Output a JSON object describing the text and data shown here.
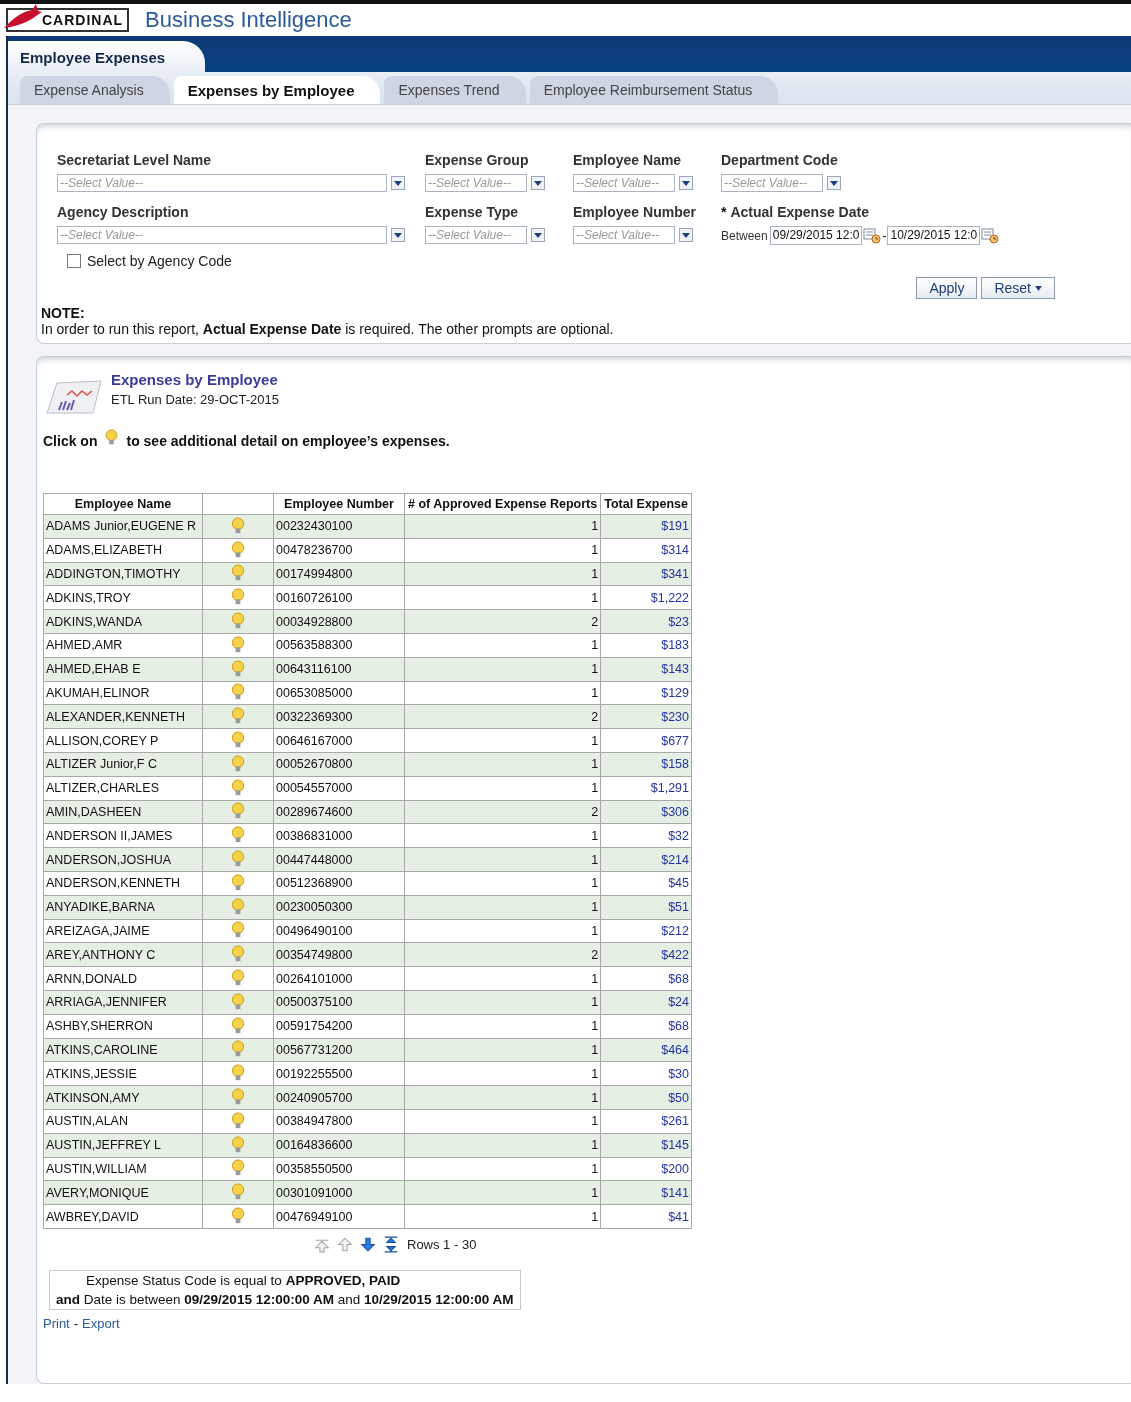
{
  "header": {
    "logo_text": "CARDINAL",
    "title": "Business Intelligence"
  },
  "dashboard": {
    "title": "Employee Expenses"
  },
  "tabs": [
    {
      "label": "Expense Analysis",
      "selected": false
    },
    {
      "label": "Expenses by Employee",
      "selected": true
    },
    {
      "label": "Expenses Trend",
      "selected": false
    },
    {
      "label": "Employee Reimbursement Status",
      "selected": false
    }
  ],
  "prompts": [
    {
      "kind": "select",
      "label": "Secretariat Level Name",
      "placeholder": "--Select Value--"
    },
    {
      "kind": "select",
      "label": "Expense Group",
      "placeholder": "--Select Value--"
    },
    {
      "kind": "select",
      "label": "Employee Name",
      "placeholder": "--Select Value--"
    },
    {
      "kind": "select",
      "label": "Department Code",
      "placeholder": "--Select Value--"
    },
    {
      "kind": "select",
      "label": "Agency Description",
      "placeholder": "--Select Value--"
    },
    {
      "kind": "select",
      "label": "Expense Type",
      "placeholder": "--Select Value--"
    },
    {
      "kind": "select",
      "label": "Employee Number",
      "placeholder": "--Select Value--"
    },
    {
      "kind": "date_range",
      "label": "Actual Expense Date",
      "required_mark": "*",
      "prefix": "Between",
      "from": "09/29/2015 12:0",
      "separator": "-",
      "to": "10/29/2015 12:0"
    }
  ],
  "agency_code_checkbox": {
    "label": "Select by Agency Code",
    "checked": false
  },
  "buttons": [
    {
      "label": "Apply",
      "kind": "plain"
    },
    {
      "label": "Reset",
      "kind": "menu"
    }
  ],
  "note": {
    "title": "NOTE:",
    "text": "In order to run this report, **Actual Expense Date** is required. The other prompts are optional."
  },
  "report": {
    "title": "Expenses by Employee",
    "etl_run_date": "ETL Run Date: 29-OCT-2015",
    "hint_before": "Click on",
    "hint_after": "to see additional detail on employee’s expenses."
  },
  "table": {
    "columns": [
      {
        "kind": "text",
        "label": "Employee Name"
      },
      {
        "kind": "detail"
      },
      {
        "kind": "text",
        "label": "Employee Number"
      },
      {
        "kind": "number",
        "label": "# of Approved Expense Reports"
      },
      {
        "kind": "money",
        "label": "Total Expense"
      }
    ],
    "rows": [
      {
        "name": "ADAMS Junior,EUGENE R",
        "number": "00232430100",
        "reports": "1",
        "total": "$191"
      },
      {
        "name": "ADAMS,ELIZABETH",
        "number": "00478236700",
        "reports": "1",
        "total": "$314"
      },
      {
        "name": "ADDINGTON,TIMOTHY",
        "number": "00174994800",
        "reports": "1",
        "total": "$341"
      },
      {
        "name": "ADKINS,TROY",
        "number": "00160726100",
        "reports": "1",
        "total": "$1,222"
      },
      {
        "name": "ADKINS,WANDA",
        "number": "00034928800",
        "reports": "2",
        "total": "$23"
      },
      {
        "name": "AHMED,AMR",
        "number": "00563588300",
        "reports": "1",
        "total": "$183"
      },
      {
        "name": "AHMED,EHAB E",
        "number": "00643116100",
        "reports": "1",
        "total": "$143"
      },
      {
        "name": "AKUMAH,ELINOR",
        "number": "00653085000",
        "reports": "1",
        "total": "$129"
      },
      {
        "name": "ALEXANDER,KENNETH",
        "number": "00322369300",
        "reports": "2",
        "total": "$230"
      },
      {
        "name": "ALLISON,COREY P",
        "number": "00646167000",
        "reports": "1",
        "total": "$677"
      },
      {
        "name": "ALTIZER Junior,F C",
        "number": "00052670800",
        "reports": "1",
        "total": "$158"
      },
      {
        "name": "ALTIZER,CHARLES",
        "number": "00054557000",
        "reports": "1",
        "total": "$1,291"
      },
      {
        "name": "AMIN,DASHEEN",
        "number": "00289674600",
        "reports": "2",
        "total": "$306"
      },
      {
        "name": "ANDERSON II,JAMES",
        "number": "00386831000",
        "reports": "1",
        "total": "$32"
      },
      {
        "name": "ANDERSON,JOSHUA",
        "number": "00447448000",
        "reports": "1",
        "total": "$214"
      },
      {
        "name": "ANDERSON,KENNETH",
        "number": "00512368900",
        "reports": "1",
        "total": "$45"
      },
      {
        "name": "ANYADIKE,BARNA",
        "number": "00230050300",
        "reports": "1",
        "total": "$51"
      },
      {
        "name": "AREIZAGA,JAIME",
        "number": "00496490100",
        "reports": "1",
        "total": "$212"
      },
      {
        "name": "AREY,ANTHONY C",
        "number": "00354749800",
        "reports": "2",
        "total": "$422"
      },
      {
        "name": "ARNN,DONALD",
        "number": "00264101000",
        "reports": "1",
        "total": "$68"
      },
      {
        "name": "ARRIAGA,JENNIFER",
        "number": "00500375100",
        "reports": "1",
        "total": "$24"
      },
      {
        "name": "ASHBY,SHERRON",
        "number": "00591754200",
        "reports": "1",
        "total": "$68"
      },
      {
        "name": "ATKINS,CAROLINE",
        "number": "00567731200",
        "reports": "1",
        "total": "$464"
      },
      {
        "name": "ATKINS,JESSIE",
        "number": "00192255500",
        "reports": "1",
        "total": "$30"
      },
      {
        "name": "ATKINSON,AMY",
        "number": "00240905700",
        "reports": "1",
        "total": "$50"
      },
      {
        "name": "AUSTIN,ALAN",
        "number": "00384947800",
        "reports": "1",
        "total": "$261"
      },
      {
        "name": "AUSTIN,JEFFREY L",
        "number": "00164836600",
        "reports": "1",
        "total": "$145"
      },
      {
        "name": "AUSTIN,WILLIAM",
        "number": "00358550500",
        "reports": "1",
        "total": "$200"
      },
      {
        "name": "AVERY,MONIQUE",
        "number": "00301091000",
        "reports": "1",
        "total": "$141"
      },
      {
        "name": "AWBREY,DAVID",
        "number": "00476949100",
        "reports": "1",
        "total": "$41"
      }
    ]
  },
  "pager": {
    "controls": [
      {
        "kind": "first",
        "disabled": true
      },
      {
        "kind": "previous",
        "disabled": true
      },
      {
        "kind": "next",
        "disabled": false
      },
      {
        "kind": "all",
        "disabled": false
      }
    ],
    "label": "Rows 1 - 30"
  },
  "filter": {
    "lines": [
      "Expense Status Code is equal to **APPROVED, PAID**",
      "**and** Date is between **09/29/2015 12:00:00 AM** and **10/29/2015 12:00:00 AM**"
    ]
  },
  "links": [
    {
      "label": "Print"
    },
    {
      "label": "Export"
    }
  ],
  "links_separator": "-"
}
